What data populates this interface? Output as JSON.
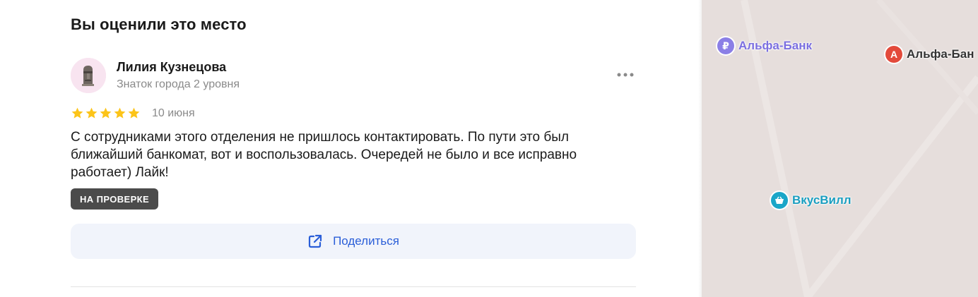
{
  "review_panel": {
    "title": "Вы оценили это место",
    "author": {
      "name": "Лилия Кузнецова",
      "level": "Знаток города 2 уровня"
    },
    "rating": {
      "stars": 5,
      "max": 5
    },
    "date": "10 июня",
    "text": "С сотрудниками этого отделения не пришлось контактировать. По пути это был ближайший банкомат, вот и воспользовалась. Очередей не было и все исправно работает) Лайк!",
    "status_badge": "НА ПРОВЕРКЕ",
    "share_label": "Поделиться",
    "more_icon": "more-dots-icon"
  },
  "map": {
    "pois": [
      {
        "label": "Альфа-Банк",
        "icon": "ruble-icon",
        "color": "#8b7fe6"
      },
      {
        "label": "Альфа-Бан",
        "icon": "alfa-bank-logo-icon",
        "color": "#e34a3b"
      },
      {
        "label": "ВкусВилл",
        "icon": "basket-icon",
        "color": "#1aa6c8"
      }
    ]
  },
  "colors": {
    "star": "#fcc419",
    "accent": "#2a5ed8",
    "badge_bg": "#4b4b4b",
    "map_bg": "#e6dedc"
  }
}
